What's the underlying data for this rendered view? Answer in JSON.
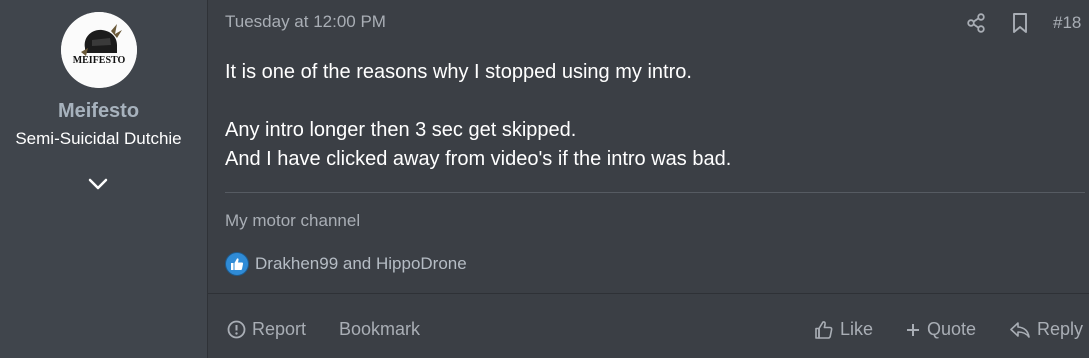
{
  "user": {
    "name": "Meifesto",
    "title": "Semi-Suicidal Dutchie",
    "avatar_text": "MEIFESTO"
  },
  "post": {
    "date": "Tuesday at 12:00 PM",
    "number": "#18",
    "paragraphs": [
      "It is one of the reasons why I stopped using my intro.",
      "Any intro longer then 3 sec get skipped.",
      "And I have clicked away from video's if the intro was bad."
    ],
    "signature": "My motor channel"
  },
  "reactions": {
    "users": "Drakhen99 and HippoDrone",
    "icon": "thumbs-up-icon",
    "badge_color": "#2f8bd6"
  },
  "footer": {
    "report": "Report",
    "bookmark": "Bookmark",
    "like": "Like",
    "quote": "Quote",
    "reply": "Reply"
  },
  "colors": {
    "background": "#3b3f45",
    "sidebar": "#40454c",
    "muted_text": "#a9aeb5",
    "username": "#a7b2bd"
  }
}
